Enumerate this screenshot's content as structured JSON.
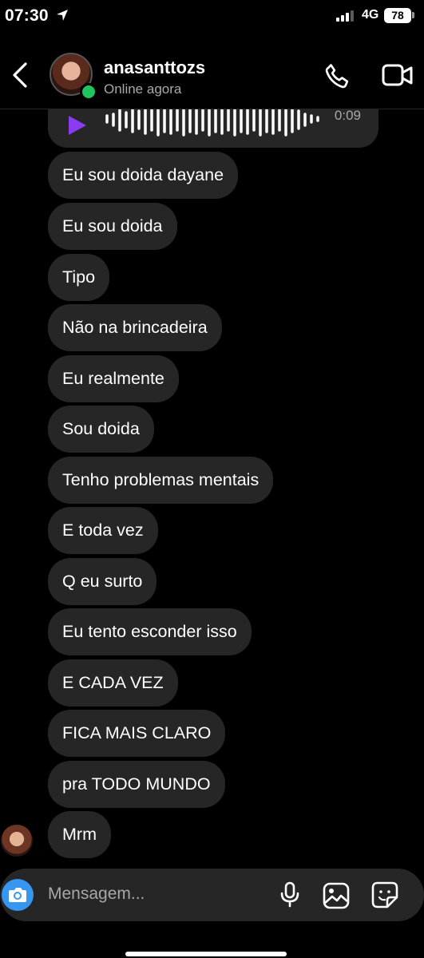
{
  "status": {
    "time": "07:30",
    "network": "4G",
    "battery": "78"
  },
  "header": {
    "username": "anasanttozs",
    "presence": "Online agora"
  },
  "audio": {
    "duration": "0:09"
  },
  "messages": [
    "Eu sou doida dayane",
    "Eu sou doida",
    "Tipo",
    "Não na brincadeira",
    "Eu realmente",
    "Sou doida",
    "Tenho problemas mentais",
    "E toda vez",
    "Q eu surto",
    "Eu tento esconder isso",
    "E CADA VEZ",
    "FICA MAIS CLARO",
    "pra TODO MUNDO",
    "Mrm"
  ],
  "composer": {
    "placeholder": "Mensagem..."
  },
  "colors": {
    "bubble": "#262626",
    "accent": "#3797f0",
    "online": "#21c35c",
    "play": "#8b3cf0"
  }
}
